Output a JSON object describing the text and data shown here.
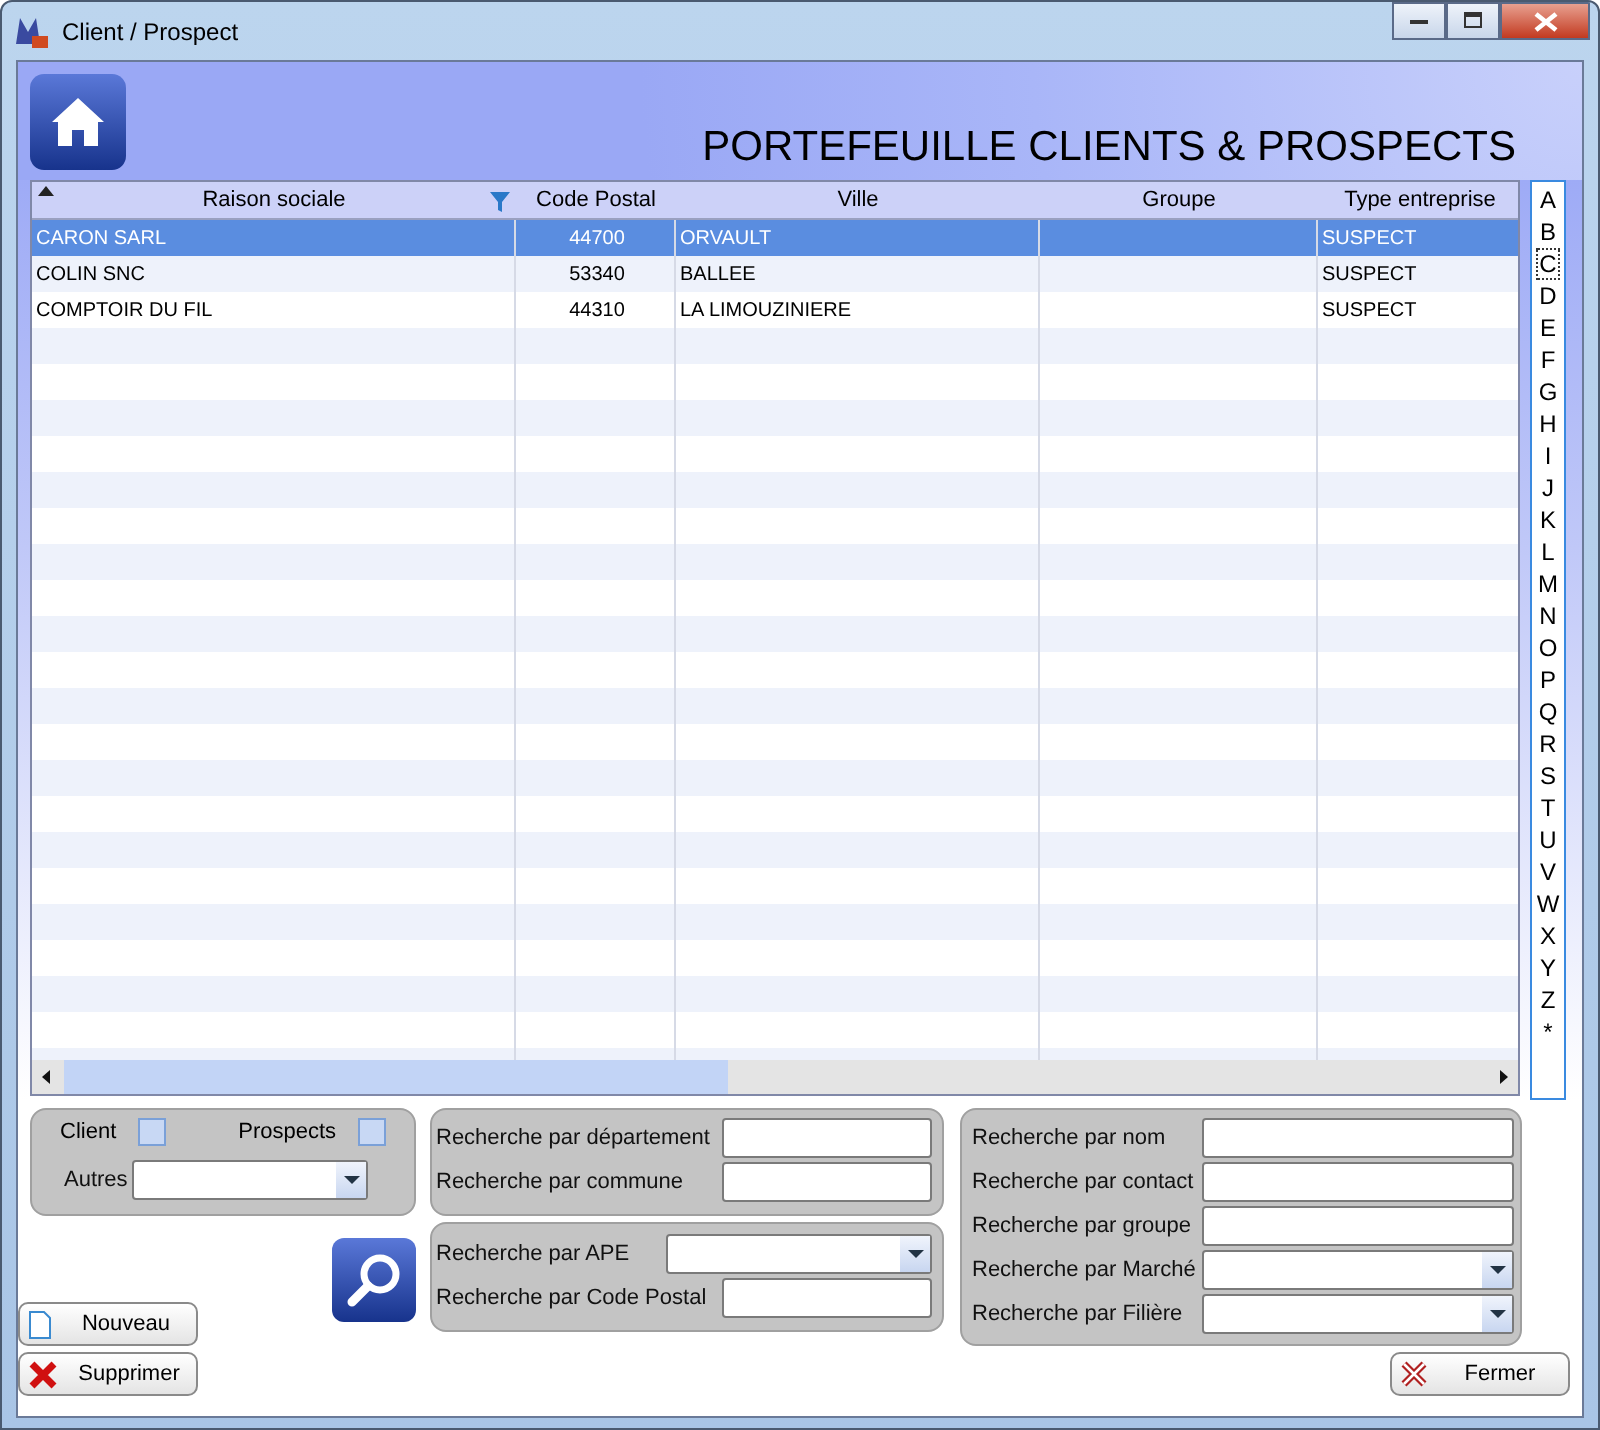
{
  "window": {
    "title": "Client / Prospect"
  },
  "header": {
    "title": "PORTEFEUILLE CLIENTS & PROSPECTS"
  },
  "table": {
    "columns": [
      {
        "label": "Raison sociale",
        "sorted": true,
        "filtered": true
      },
      {
        "label": "Code Postal",
        "sorted": false,
        "filtered": false
      },
      {
        "label": "Ville",
        "sorted": false,
        "filtered": false
      },
      {
        "label": "Groupe",
        "sorted": false,
        "filtered": false
      },
      {
        "label": "Type entreprise",
        "sorted": false,
        "filtered": false
      }
    ],
    "rows": [
      {
        "selected": true,
        "cells": [
          "CARON SARL",
          "44700",
          "ORVAULT",
          "",
          "SUSPECT"
        ]
      },
      {
        "selected": false,
        "cells": [
          "COLIN SNC",
          "53340",
          "BALLEE",
          "",
          "SUSPECT"
        ]
      },
      {
        "selected": false,
        "cells": [
          "COMPTOIR DU FIL",
          "44310",
          "LA LIMOUZINIERE",
          "",
          "SUSPECT"
        ]
      }
    ]
  },
  "alphabet": [
    {
      "label": "A",
      "selected": false
    },
    {
      "label": "B",
      "selected": false
    },
    {
      "label": "C",
      "selected": true
    },
    {
      "label": "D",
      "selected": false
    },
    {
      "label": "E",
      "selected": false
    },
    {
      "label": "F",
      "selected": false
    },
    {
      "label": "G",
      "selected": false
    },
    {
      "label": "H",
      "selected": false
    },
    {
      "label": "I",
      "selected": false
    },
    {
      "label": "J",
      "selected": false
    },
    {
      "label": "K",
      "selected": false
    },
    {
      "label": "L",
      "selected": false
    },
    {
      "label": "M",
      "selected": false
    },
    {
      "label": "N",
      "selected": false
    },
    {
      "label": "O",
      "selected": false
    },
    {
      "label": "P",
      "selected": false
    },
    {
      "label": "Q",
      "selected": false
    },
    {
      "label": "R",
      "selected": false
    },
    {
      "label": "S",
      "selected": false
    },
    {
      "label": "T",
      "selected": false
    },
    {
      "label": "U",
      "selected": false
    },
    {
      "label": "V",
      "selected": false
    },
    {
      "label": "W",
      "selected": false
    },
    {
      "label": "X",
      "selected": false
    },
    {
      "label": "Y",
      "selected": false
    },
    {
      "label": "Z",
      "selected": false
    },
    {
      "label": "*",
      "selected": false
    }
  ],
  "filters": {
    "checkboxes": [
      {
        "label": "Client",
        "checked": false
      },
      {
        "label": "Prospects",
        "checked": false
      }
    ],
    "other": {
      "label": "Autres",
      "kind": "dropdown"
    }
  },
  "search_groups": [
    [
      {
        "label": "Recherche par département",
        "kind": "text"
      },
      {
        "label": "Recherche par commune",
        "kind": "text"
      }
    ],
    [
      {
        "label": "Recherche par APE",
        "kind": "dropdown"
      },
      {
        "label": "Recherche par Code Postal",
        "kind": "text"
      }
    ],
    [
      {
        "label": "Recherche par nom",
        "kind": "text"
      },
      {
        "label": "Recherche par contact",
        "kind": "text"
      },
      {
        "label": "Recherche par groupe",
        "kind": "text"
      },
      {
        "label": "Recherche par Marché",
        "kind": "dropdown"
      },
      {
        "label": "Recherche par Filière",
        "kind": "dropdown"
      }
    ]
  ],
  "buttons": {
    "new": "Nouveau",
    "delete": "Supprimer",
    "close": "Fermer"
  }
}
